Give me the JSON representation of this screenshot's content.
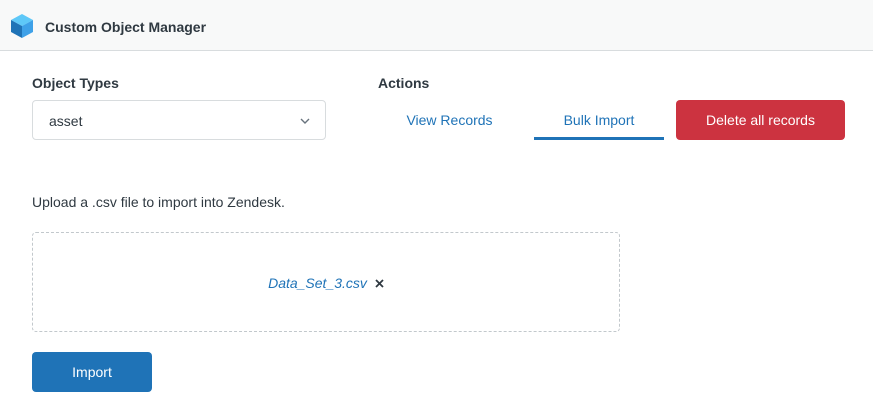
{
  "header": {
    "title": "Custom Object Manager",
    "icon": "cube-icon",
    "icon_colors": {
      "top": "#5ec8f8",
      "left": "#1f73b7",
      "right": "#3ea1e8"
    }
  },
  "object_types": {
    "label": "Object Types",
    "selected": "asset"
  },
  "actions": {
    "label": "Actions",
    "tabs": [
      {
        "label": "View Records",
        "selected": false
      },
      {
        "label": "Bulk Import",
        "selected": true
      }
    ],
    "delete_label": "Delete all records"
  },
  "upload": {
    "hint": "Upload a .csv file to import into Zendesk.",
    "file_name": "Data_Set_3.csv",
    "remove_icon": "close-icon"
  },
  "import_label": "Import",
  "colors": {
    "accent": "#1f73b7",
    "danger": "#cc3340",
    "text": "#2f3941"
  }
}
